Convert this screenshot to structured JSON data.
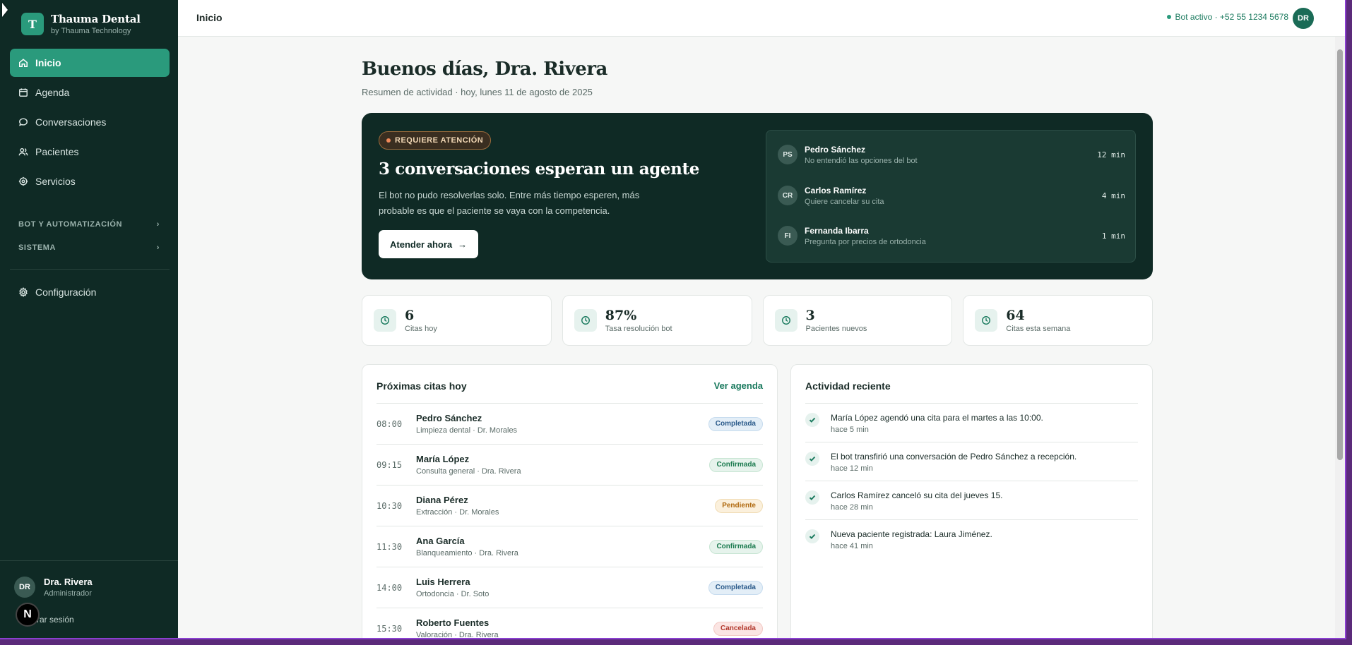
{
  "sidebar": {
    "brand_initial": "T",
    "brand_name": "Thauma Dental",
    "brand_sub": "by Thauma Technology",
    "items": [
      {
        "label": "Inicio",
        "icon": "home-icon",
        "active": true
      },
      {
        "label": "Agenda",
        "icon": "calendar-icon"
      },
      {
        "label": "Conversaciones",
        "icon": "chat-icon"
      },
      {
        "label": "Pacientes",
        "icon": "users-icon"
      },
      {
        "label": "Servicios",
        "icon": "services-icon"
      }
    ],
    "sections": [
      "BOT Y AUTOMATIZACIÓN",
      "SISTEMA"
    ],
    "config_label": "Configuración",
    "user": {
      "initials": "DR",
      "name": "Dra. Rivera",
      "role": "Administrador"
    },
    "logout_label": "rrar sesión",
    "n_badge": "N"
  },
  "topbar": {
    "title": "Inicio",
    "status": "Bot activo · +52 55 1234 5678",
    "avatar": "DR"
  },
  "main": {
    "greeting": "Buenos días, Dra. Rivera",
    "subtitle": "Resumen de actividad · hoy, lunes 11 de agosto de 2025",
    "alert": {
      "pill": "REQUIERE ATENCIÓN",
      "title": "3 conversaciones esperan un agente",
      "desc": "El bot no pudo resolverlas solo. Entre más tiempo esperen, más probable es que el paciente se vaya con la competencia.",
      "button": "Atender ahora",
      "queue": [
        {
          "initials": "PS",
          "name": "Pedro Sánchez",
          "reason": "No entendió las opciones del bot",
          "time": "12 min"
        },
        {
          "initials": "CR",
          "name": "Carlos Ramírez",
          "reason": "Quiere cancelar su cita",
          "time": "4 min"
        },
        {
          "initials": "FI",
          "name": "Fernanda Ibarra",
          "reason": "Pregunta por precios de ortodoncia",
          "time": "1 min"
        }
      ]
    },
    "stats": [
      {
        "value": "6",
        "label": "Citas hoy"
      },
      {
        "value": "87%",
        "label": "Tasa resolución bot"
      },
      {
        "value": "3",
        "label": "Pacientes nuevos"
      },
      {
        "value": "64",
        "label": "Citas esta semana"
      }
    ],
    "appointments": {
      "title": "Próximas citas hoy",
      "link": "Ver agenda",
      "rows": [
        {
          "time": "08:00",
          "name": "Pedro Sánchez",
          "detail": "Limpieza dental · Dr. Morales",
          "status": "Completada",
          "kind": "done"
        },
        {
          "time": "09:15",
          "name": "María López",
          "detail": "Consulta general · Dra. Rivera",
          "status": "Confirmada",
          "kind": "conf"
        },
        {
          "time": "10:30",
          "name": "Diana Pérez",
          "detail": "Extracción · Dr. Morales",
          "status": "Pendiente",
          "kind": "pend"
        },
        {
          "time": "11:30",
          "name": "Ana García",
          "detail": "Blanqueamiento · Dra. Rivera",
          "status": "Confirmada",
          "kind": "conf"
        },
        {
          "time": "14:00",
          "name": "Luis Herrera",
          "detail": "Ortodoncia · Dr. Soto",
          "status": "Completada",
          "kind": "done"
        },
        {
          "time": "15:30",
          "name": "Roberto Fuentes",
          "detail": "Valoración · Dra. Rivera",
          "status": "Cancelada",
          "kind": "canc"
        }
      ]
    },
    "activity": {
      "title": "Actividad reciente",
      "items": [
        {
          "text": "María López agendó una cita para el martes a las 10:00.",
          "ago": "hace 5 min"
        },
        {
          "text": "El bot transfirió una conversación de Pedro Sánchez a recepción.",
          "ago": "hace 12 min"
        },
        {
          "text": "Carlos Ramírez canceló su cita del jueves 15.",
          "ago": "hace 28 min"
        },
        {
          "text": "Nueva paciente registrada: Laura Jiménez.",
          "ago": "hace 41 min"
        }
      ]
    }
  }
}
